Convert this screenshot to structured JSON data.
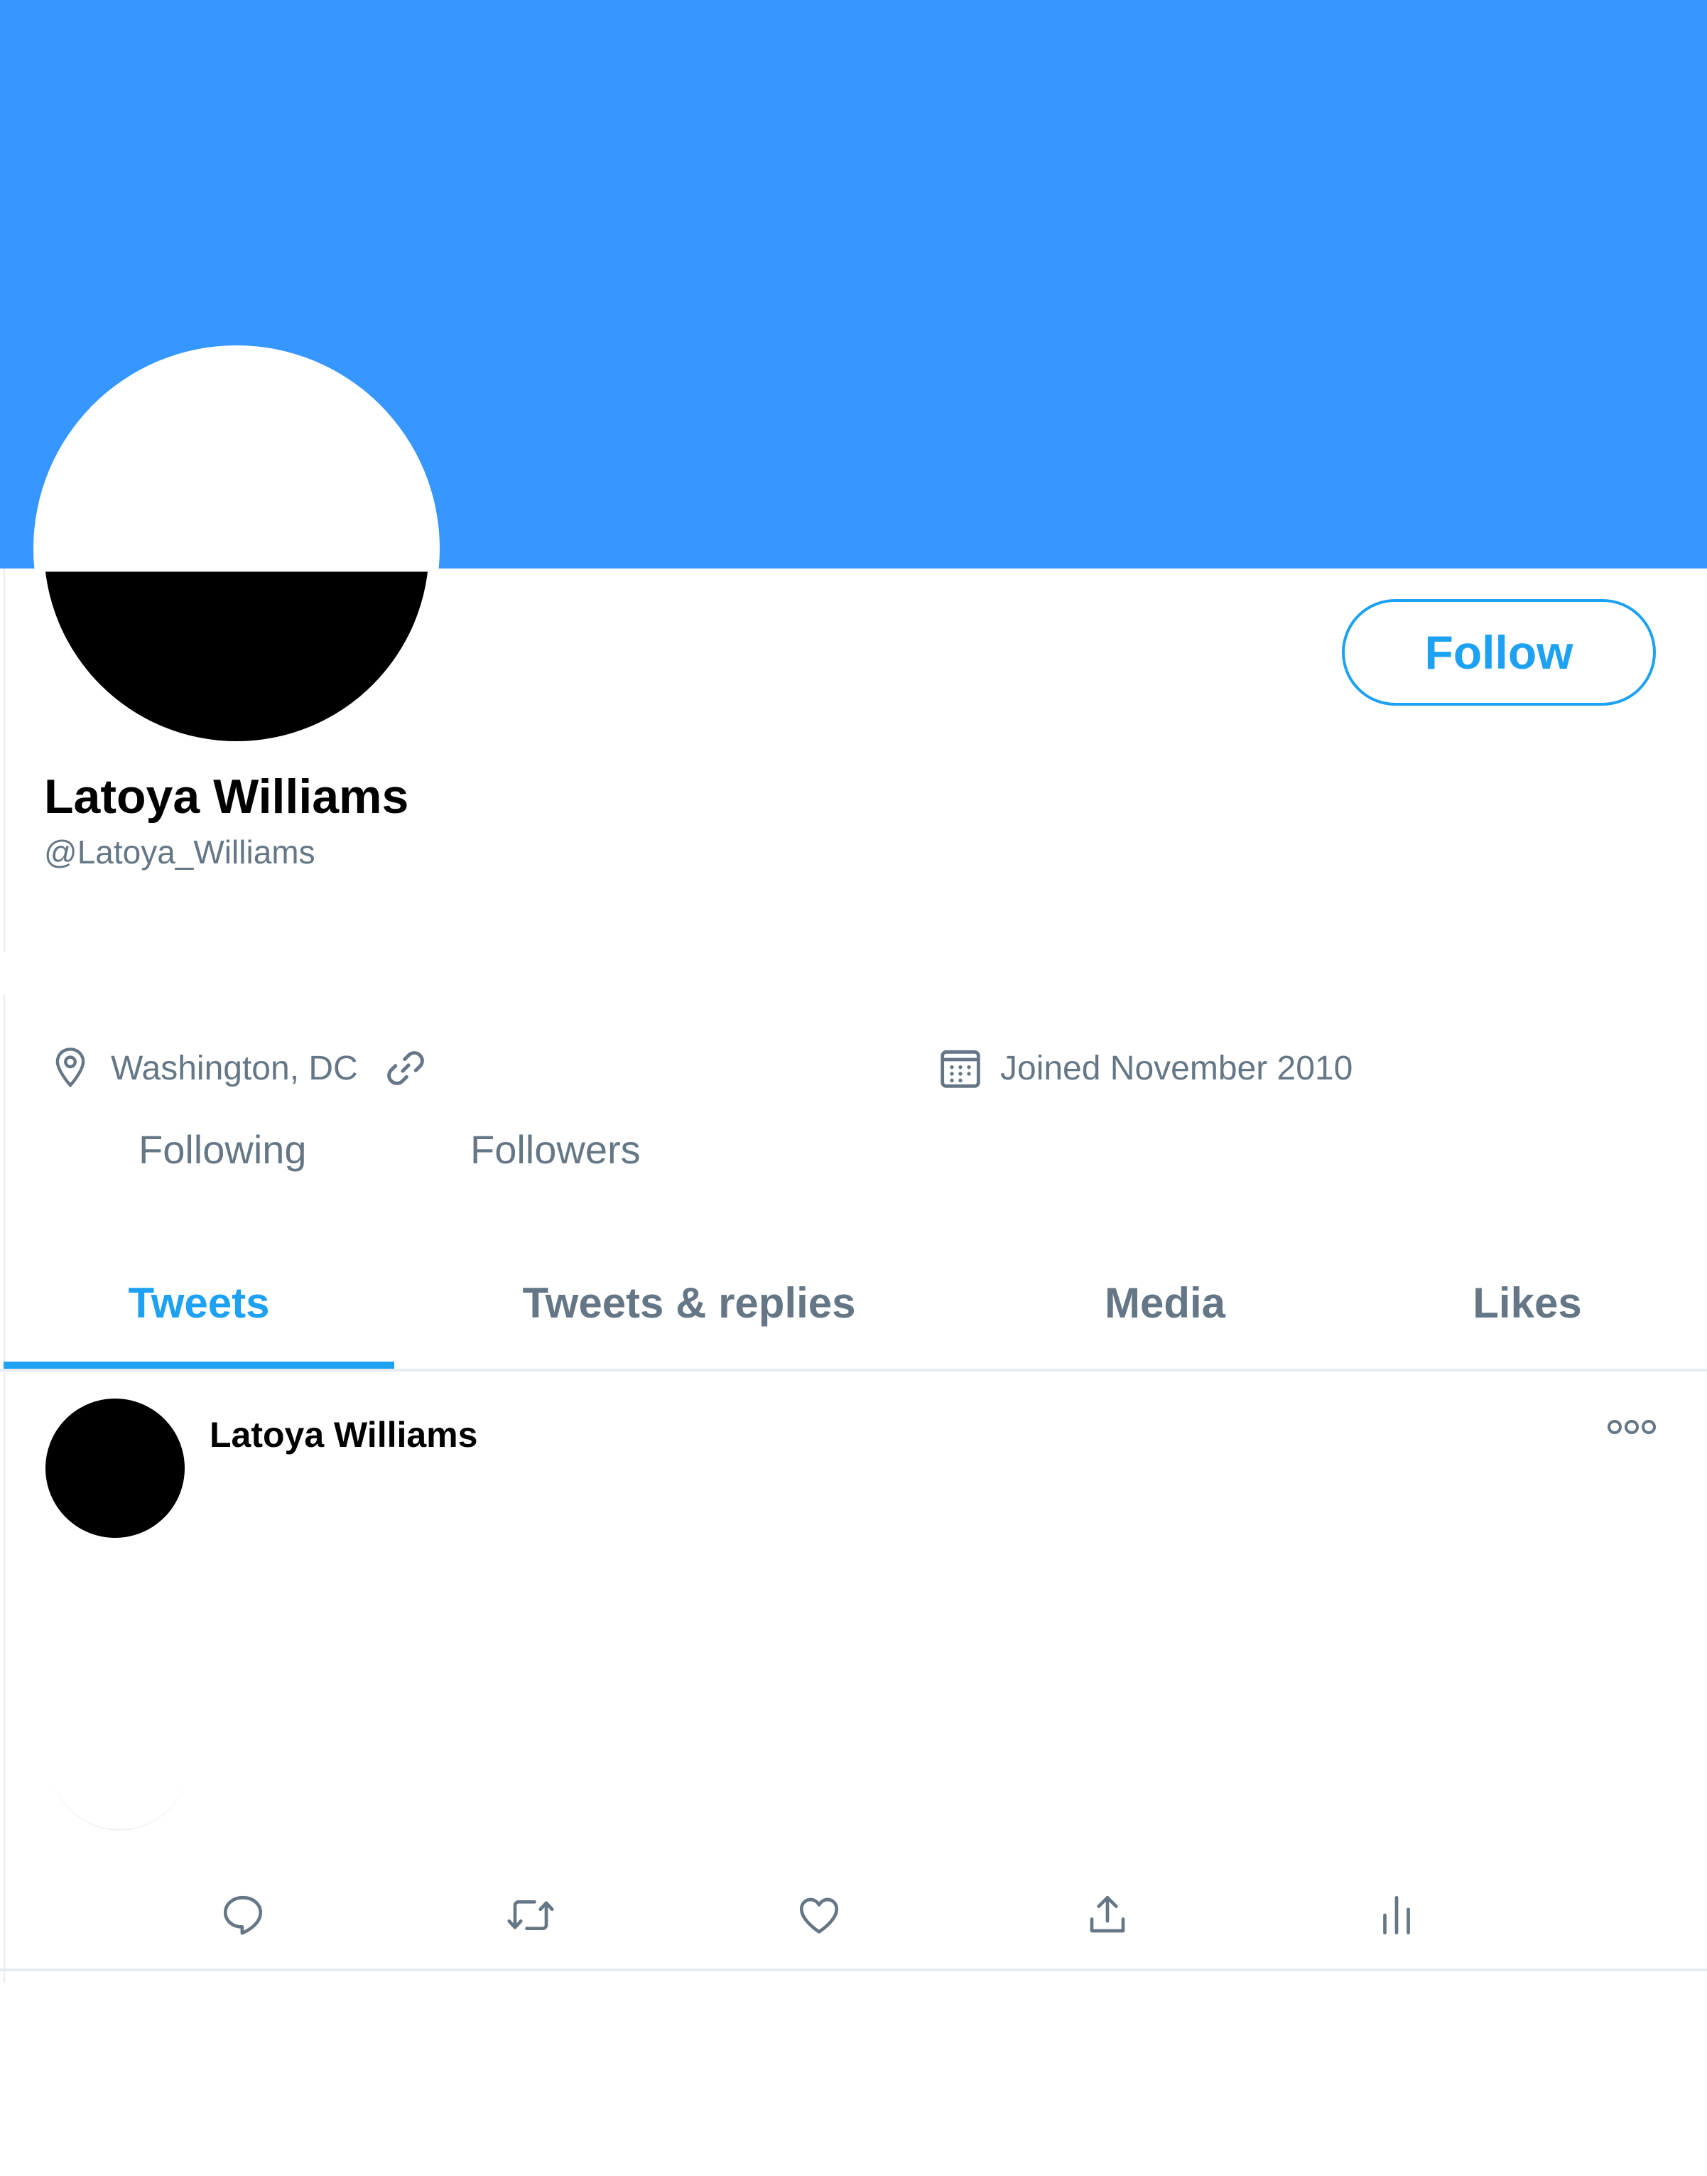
{
  "colors": {
    "banner": "#3597FF",
    "accent": "#1DA1F2",
    "secondary_text": "#657786",
    "divider": "#E6ECF0"
  },
  "profile": {
    "display_name": "Latoya Williams",
    "handle": "@Latoya_Williams",
    "location": "Washington, DC",
    "joined": "Joined November 2010",
    "following_label": "Following",
    "followers_label": "Followers",
    "follow_button_label": "Follow"
  },
  "tabs": [
    {
      "label": "Tweets",
      "active": true
    },
    {
      "label": "Tweets & replies",
      "active": false
    },
    {
      "label": "Media",
      "active": false
    },
    {
      "label": "Likes",
      "active": false
    }
  ],
  "tweet": {
    "author": "Latoya Williams"
  },
  "icons": {
    "location": "location-pin-icon",
    "link": "link-icon",
    "calendar": "calendar-icon",
    "more": "more-options-icon",
    "reply": "reply-icon",
    "retweet": "retweet-icon",
    "like": "heart-icon",
    "share": "share-icon",
    "analytics": "analytics-icon"
  }
}
